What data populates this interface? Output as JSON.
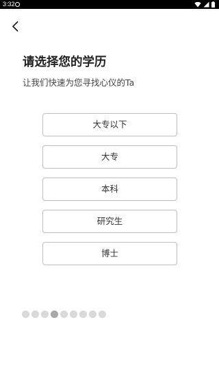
{
  "status_bar": {
    "time": "3:32"
  },
  "header": {
    "title": "请选择您的学历",
    "subtitle": "让我们快速为您寻找心仪的Ta"
  },
  "options": [
    {
      "label": "大专以下"
    },
    {
      "label": "大专"
    },
    {
      "label": "本科"
    },
    {
      "label": "研究生"
    },
    {
      "label": "博士"
    }
  ],
  "progress": {
    "total_steps": 9,
    "current_step": 4
  },
  "icons": {
    "back": "chevron-left-icon",
    "wifi": "wifi-icon",
    "signal": "signal-icon",
    "battery": "battery-icon"
  },
  "colors": {
    "option_border": "#bfbfbf",
    "dot_inactive": "#d9d9d9",
    "dot_active": "#a8a8a8"
  }
}
